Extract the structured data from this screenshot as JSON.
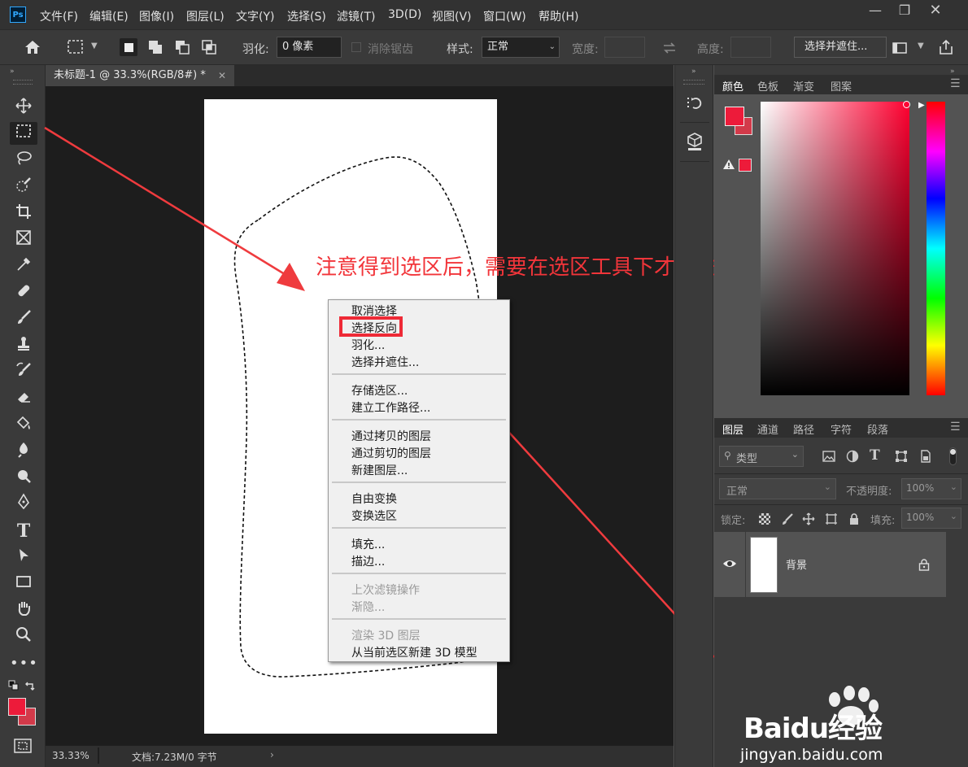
{
  "app": {
    "logo": "Ps"
  },
  "menu": [
    "文件(F)",
    "编辑(E)",
    "图像(I)",
    "图层(L)",
    "文字(Y)",
    "选择(S)",
    "滤镜(T)",
    "3D(D)",
    "视图(V)",
    "窗口(W)",
    "帮助(H)"
  ],
  "options": {
    "feather_label": "羽化:",
    "feather_value": "0 像素",
    "antialias_label": "消除锯齿",
    "style_label": "样式:",
    "style_value": "正常",
    "width_label": "宽度:",
    "height_label": "高度:",
    "select_mask_label": "选择并遮住..."
  },
  "document": {
    "tab_title": "未标题-1 @ 33.3%(RGB/8#) *",
    "zoom": "33.33%",
    "doc_info": "文档:7.23M/0 字节"
  },
  "context_menu": {
    "groups": [
      {
        "items": [
          {
            "label": "取消选择"
          },
          {
            "label": "选择反向",
            "highlighted": true
          },
          {
            "label": "羽化..."
          },
          {
            "label": "选择并遮住..."
          }
        ]
      },
      {
        "items": [
          {
            "label": "存储选区..."
          },
          {
            "label": "建立工作路径..."
          }
        ]
      },
      {
        "items": [
          {
            "label": "通过拷贝的图层"
          },
          {
            "label": "通过剪切的图层"
          },
          {
            "label": "新建图层..."
          }
        ]
      },
      {
        "items": [
          {
            "label": "自由变换"
          },
          {
            "label": "变换选区"
          }
        ]
      },
      {
        "items": [
          {
            "label": "填充..."
          },
          {
            "label": "描边..."
          }
        ]
      },
      {
        "items": [
          {
            "label": "上次滤镜操作",
            "disabled": true
          },
          {
            "label": "渐隐...",
            "disabled": true
          }
        ]
      },
      {
        "items": [
          {
            "label": "渲染 3D 图层",
            "disabled": true
          },
          {
            "label": "从当前选区新建 3D 模型"
          }
        ]
      }
    ]
  },
  "annotation": {
    "text": "注意得到选区后，需要在选区工具下才能进行反选",
    "color": "#f2353a"
  },
  "color_panel": {
    "tabs": [
      "颜色",
      "色板",
      "渐变",
      "图案"
    ],
    "foreground": "#ed1b3a",
    "background": "#d33a4a"
  },
  "layers_panel": {
    "tabs": [
      "图层",
      "通道",
      "路径",
      "字符",
      "段落"
    ],
    "filter_label": "类型",
    "blend_mode": "正常",
    "opacity_label": "不透明度:",
    "opacity_value": "100%",
    "lock_label": "锁定:",
    "fill_label": "填充:",
    "fill_value": "100%",
    "layers": [
      {
        "name": "背景"
      }
    ]
  },
  "watermark": {
    "brand": "Baidu经验",
    "url": "jingyan.baidu.com"
  }
}
